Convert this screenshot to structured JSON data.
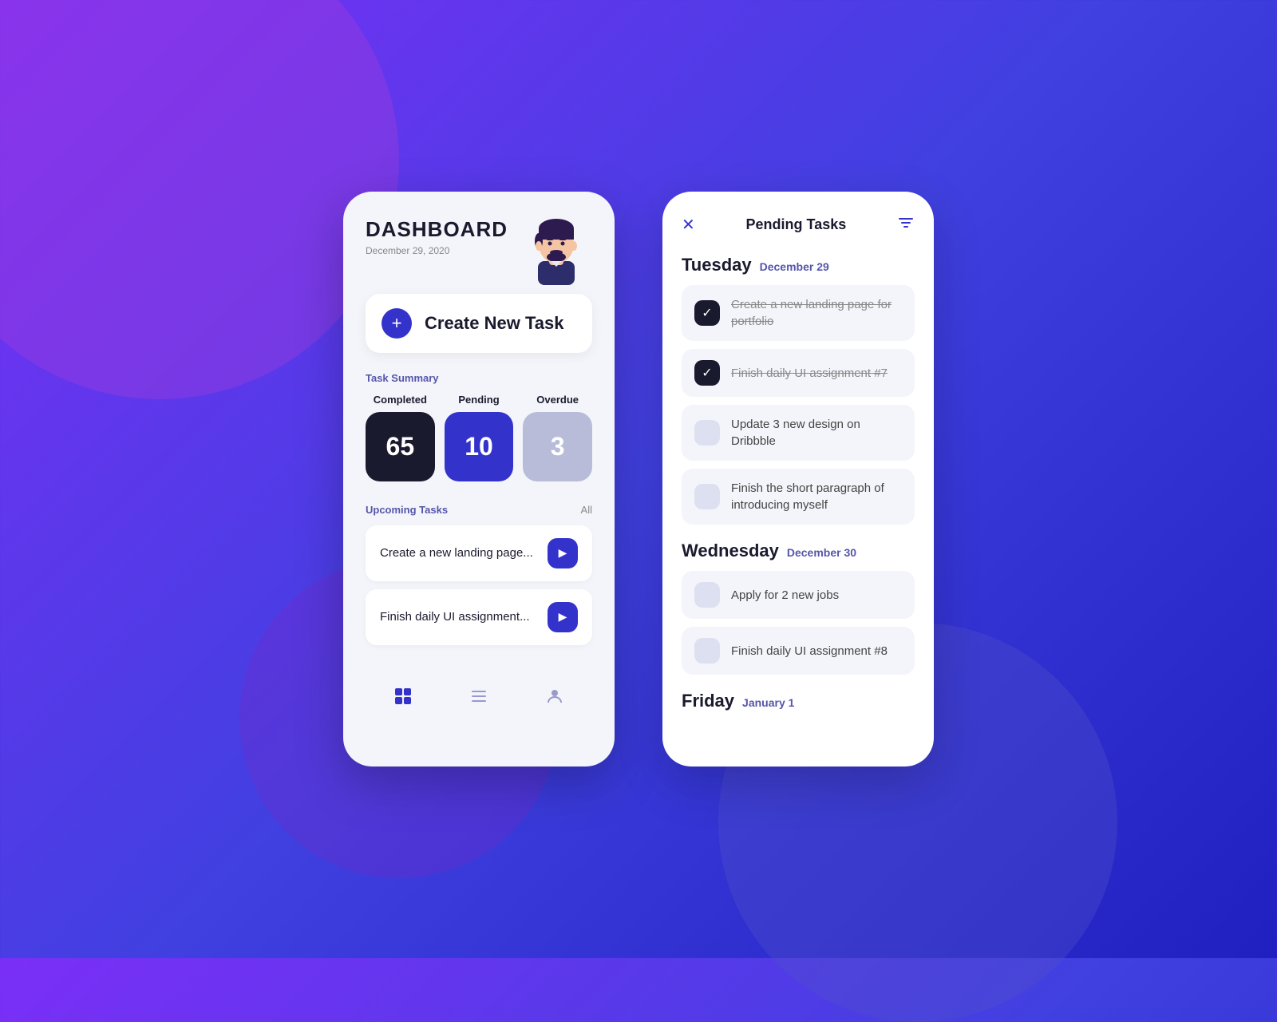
{
  "background": {
    "color1": "#7b2ff7",
    "color2": "#4040e0"
  },
  "dashboard": {
    "title": "DASHBOARD",
    "date": "December 29, 2020",
    "create_task_label": "Create New Task",
    "task_summary_label": "Task Summary",
    "completed_label": "Completed",
    "pending_label": "Pending",
    "overdue_label": "Overdue",
    "completed_count": "65",
    "pending_count": "10",
    "overdue_count": "3",
    "upcoming_label": "Upcoming Tasks",
    "upcoming_all": "All",
    "upcoming_tasks": [
      {
        "text": "Create a new landing page..."
      },
      {
        "text": "Finish daily UI assignment..."
      }
    ],
    "nav_items": [
      "grid-icon",
      "list-icon",
      "user-icon"
    ]
  },
  "pending_tasks": {
    "title": "Pending Tasks",
    "day_groups": [
      {
        "day": "Tuesday",
        "date": "December 29",
        "tasks": [
          {
            "text": "Create a new landing page for portfolio",
            "done": true
          },
          {
            "text": "Finish daily UI assignment #7",
            "done": true
          },
          {
            "text": "Update 3 new design on Dribbble",
            "done": false
          },
          {
            "text": "Finish the short paragraph of introducing myself",
            "done": false
          }
        ]
      },
      {
        "day": "Wednesday",
        "date": "December 30",
        "tasks": [
          {
            "text": "Apply for 2 new jobs",
            "done": false
          },
          {
            "text": "Finish daily UI assignment #8",
            "done": false
          }
        ]
      },
      {
        "day": "Friday",
        "date": "January 1",
        "tasks": []
      }
    ]
  }
}
